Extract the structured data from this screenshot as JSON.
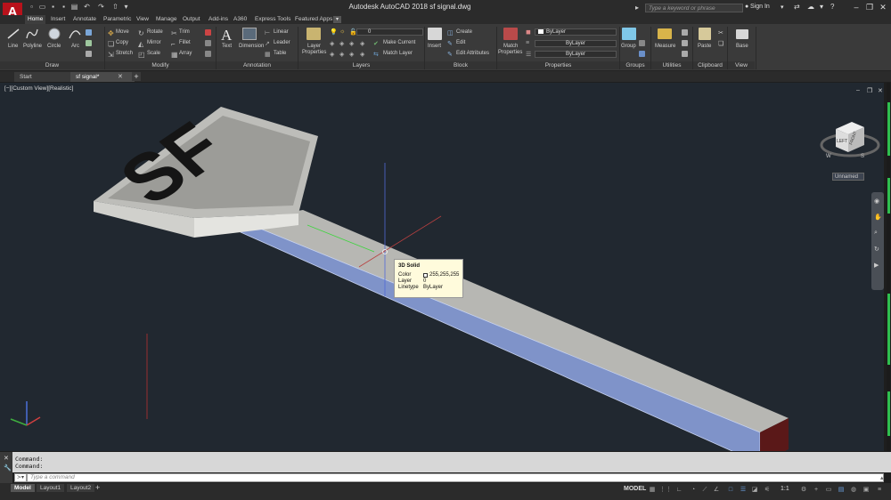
{
  "app": {
    "logo": "A",
    "title": "Autodesk AutoCAD 2018   sf signal.dwg"
  },
  "header": {
    "search_placeholder": "Type a keyword or phrase",
    "sign_in": "Sign In",
    "help": "?"
  },
  "ribbon_tabs": [
    "Home",
    "Insert",
    "Annotate",
    "Parametric",
    "View",
    "Manage",
    "Output",
    "Add-ins",
    "A360",
    "Express Tools",
    "Featured Apps"
  ],
  "draw": {
    "line": "Line",
    "polyline": "Polyline",
    "circle": "Circle",
    "arc": "Arc",
    "label": "Draw"
  },
  "modify": {
    "move": "Move",
    "rotate": "Rotate",
    "trim": "Trim",
    "copy": "Copy",
    "mirror": "Mirror",
    "fillet": "Fillet",
    "stretch": "Stretch",
    "scale": "Scale",
    "array": "Array",
    "label": "Modify"
  },
  "annotation": {
    "text": "Text",
    "dimension": "Dimension",
    "linear": "Linear",
    "leader": "Leader",
    "table": "Table",
    "label": "Annotation"
  },
  "layers": {
    "layer_properties_1": "Layer",
    "layer_properties_2": "Properties",
    "current_layer": "0",
    "make_current": "Make Current",
    "match_layer": "Match Layer",
    "label": "Layers"
  },
  "block": {
    "insert": "Insert",
    "create": "Create",
    "edit": "Edit",
    "edit_attributes": "Edit Attributes",
    "label": "Block"
  },
  "properties": {
    "match_1": "Match",
    "match_2": "Properties",
    "color": "ByLayer",
    "linetype": "ByLayer",
    "lineweight": "ByLayer",
    "label": "Properties"
  },
  "groups": {
    "group": "Group",
    "label": "Groups"
  },
  "utilities": {
    "measure": "Measure",
    "label": "Utilities"
  },
  "clipboard": {
    "paste": "Paste",
    "label": "Clipboard"
  },
  "view_panel": {
    "base": "Base",
    "label": "View"
  },
  "file_tabs": [
    "Start",
    "sf signal*"
  ],
  "viewport": {
    "label": "[−][Custom View][Realistic]",
    "sign_text": "SF",
    "viewcube_face": "LEFT",
    "viewcube_side": "FRONT",
    "named_view": "Unnamed",
    "compass_w": "W",
    "compass_s": "S"
  },
  "tooltip": {
    "title": "3D Solid",
    "rows": [
      {
        "k": "Color",
        "v": "255,255,255"
      },
      {
        "k": "Layer",
        "v": "0"
      },
      {
        "k": "Linetype",
        "v": "ByLayer"
      }
    ]
  },
  "command": {
    "history": [
      "Command:",
      "Command:"
    ],
    "placeholder": "Type a command"
  },
  "layout_tabs": [
    "Model",
    "Layout1",
    "Layout2"
  ],
  "status": {
    "model": "MODEL",
    "scale": "1:1"
  },
  "colors": {
    "accent": "#b8121b",
    "selection": "#7f93c9",
    "grip_blue": "#4a6fd8"
  }
}
